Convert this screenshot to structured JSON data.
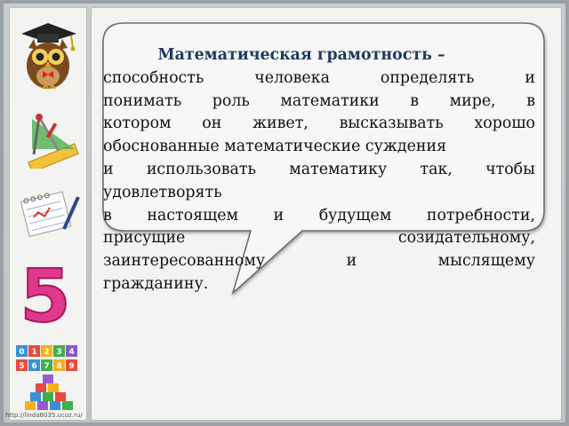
{
  "slide": {
    "heading": "Математическая грамотность –",
    "lines": [
      "способность человека определять и",
      "понимать роль математики в мире, в",
      "котором он живет, высказывать хорошо",
      "обоснованные математические суждения",
      "и использовать математику так, чтобы",
      "удовлетворять",
      "в настоящем и будущем потребности,",
      "присущие созидательному,",
      "заинтересованному и мыслящему",
      "гражданину."
    ],
    "line_styles": [
      "j",
      "j",
      "j",
      "l",
      "j",
      "l",
      "j",
      "j",
      "j",
      "l"
    ]
  },
  "sidebar": {
    "icons": [
      "owl-icon",
      "compass-ruler-icon",
      "notebook-pen-icon",
      "digit-five-icon",
      "number-blocks-icon",
      "toy-cubes-icon"
    ],
    "blocks_top_digits": [
      "0",
      "1",
      "2",
      "3",
      "4"
    ],
    "blocks_bottom_digits": [
      "5",
      "6",
      "7",
      "8",
      "9"
    ],
    "digit_five": "5"
  },
  "footer": {
    "url": "http://linda6035.ucoz.ru/"
  },
  "colors": {
    "heading": "#1f3b5c",
    "bubble_fill": "#f7f7f7",
    "bubble_border": "#6f6f6f",
    "digit_five": "#e0398c"
  }
}
